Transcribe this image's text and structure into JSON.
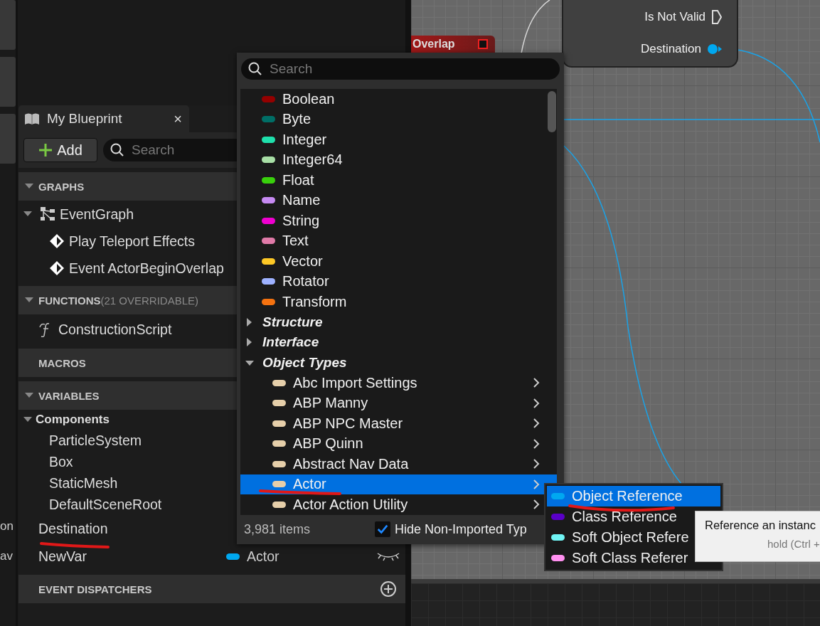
{
  "side_strip": {
    "labels": [
      "on",
      "av"
    ]
  },
  "my_blueprint": {
    "tab": {
      "title": "My Blueprint",
      "close": "×"
    },
    "add_button": "Add",
    "search": {
      "placeholder": "Search"
    },
    "sections": [
      {
        "title": "GRAPHS",
        "expanded": true,
        "items": [
          {
            "label": "EventGraph",
            "kind": "graph",
            "expanded": true,
            "children": [
              {
                "label": "Play Teleport Effects",
                "kind": "event"
              },
              {
                "label": "Event ActorBeginOverlap",
                "kind": "event"
              }
            ]
          }
        ]
      },
      {
        "title": "FUNCTIONS",
        "note": "(21 OVERRIDABLE)",
        "expanded": true,
        "items": [
          {
            "label": "ConstructionScript",
            "kind": "function"
          }
        ]
      },
      {
        "title": "MACROS"
      },
      {
        "title": "VARIABLES",
        "expanded": true,
        "items": [
          {
            "label": "Components",
            "kind": "category",
            "expanded": true,
            "children": [
              {
                "label": "ParticleSystem",
                "kind": "component"
              },
              {
                "label": "Box",
                "kind": "component"
              },
              {
                "label": "StaticMesh",
                "kind": "component"
              },
              {
                "label": "DefaultSceneRoot",
                "kind": "component"
              }
            ]
          },
          {
            "label": "Destination",
            "kind": "variable"
          },
          {
            "label": "NewVar",
            "kind": "variable",
            "type": "Actor",
            "color": "#00a8f0",
            "visible": false
          }
        ]
      },
      {
        "title": "EVENT DISPATCHERS",
        "can_add": true
      }
    ]
  },
  "graph": {
    "nodes": [
      {
        "kind": "event",
        "title": "Overlap"
      },
      {
        "kind": "function",
        "pins": [
          {
            "label": "Is Not Valid",
            "kind": "exec"
          },
          {
            "label": "Destination",
            "kind": "data",
            "color": "#00a8f0"
          }
        ]
      }
    ]
  },
  "type_picker": {
    "search": {
      "placeholder": "Search"
    },
    "items": [
      {
        "label": "Boolean",
        "kind": "type",
        "color": "#940000"
      },
      {
        "label": "Byte",
        "kind": "type",
        "color": "#006e66"
      },
      {
        "label": "Integer",
        "kind": "type",
        "color": "#1fe0ac"
      },
      {
        "label": "Integer64",
        "kind": "type",
        "color": "#a8dfa6"
      },
      {
        "label": "Float",
        "kind": "type",
        "color": "#39d00c"
      },
      {
        "label": "Name",
        "kind": "type",
        "color": "#c68af2"
      },
      {
        "label": "String",
        "kind": "type",
        "color": "#f000d0"
      },
      {
        "label": "Text",
        "kind": "type",
        "color": "#e07aa8"
      },
      {
        "label": "Vector",
        "kind": "type",
        "color": "#fdc826"
      },
      {
        "label": "Rotator",
        "kind": "type",
        "color": "#9eb2ff"
      },
      {
        "label": "Transform",
        "kind": "type",
        "color": "#f47210"
      },
      {
        "label": "Structure",
        "kind": "category",
        "expanded": false
      },
      {
        "label": "Interface",
        "kind": "category",
        "expanded": false
      },
      {
        "label": "Object Types",
        "kind": "category",
        "expanded": true,
        "children": [
          {
            "label": "Abc Import Settings",
            "color": "#e6cfaa",
            "selected": false
          },
          {
            "label": "ABP Manny",
            "color": "#e6cfaa",
            "selected": false
          },
          {
            "label": "ABP NPC Master",
            "color": "#e6cfaa",
            "selected": false
          },
          {
            "label": "ABP Quinn",
            "color": "#e6cfaa",
            "selected": false
          },
          {
            "label": "Abstract Nav Data",
            "color": "#e6cfaa",
            "selected": false
          },
          {
            "label": "Actor",
            "color": "#e6cfaa",
            "selected": true
          },
          {
            "label": "Actor Action Utility",
            "color": "#e6cfaa",
            "selected": false
          }
        ]
      }
    ],
    "count": "3,981 items",
    "hide_option": {
      "label": "Hide Non-Imported Typ",
      "checked": true
    }
  },
  "reference_menu": [
    {
      "label": "Object Reference",
      "color": "#00a8f0",
      "selected": true
    },
    {
      "label": "Class Reference",
      "color": "#5a00c8",
      "selected": false
    },
    {
      "label": "Soft Object Refere",
      "color": "#70f4f4",
      "selected": false
    },
    {
      "label": "Soft Class Referer",
      "color": "#ff90f0",
      "selected": false
    }
  ],
  "tooltip": {
    "lines": [
      "Reference an instanc",
      "hold (Ctrl +"
    ]
  }
}
